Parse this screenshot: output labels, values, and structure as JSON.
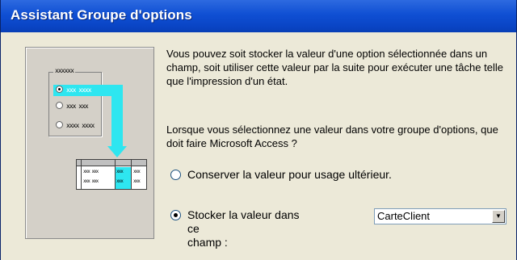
{
  "window": {
    "title": "Assistant Groupe d'options"
  },
  "illustration": {
    "group_label": "xxxxxx",
    "options": [
      "xxx xxxx",
      "xxx xxx",
      "xxxx xxxx"
    ],
    "table_cells": [
      "xxx xxx",
      "xxx",
      "xxx",
      "xxx xxx",
      "xxx",
      "xxx"
    ]
  },
  "content": {
    "paragraph1": "Vous pouvez soit stocker la valeur d'une option sélectionnée dans un champ, soit utiliser cette valeur par la suite pour exécuter une tâche telle que l'impression d'un état.",
    "paragraph2": "Lorsque vous sélectionnez une valeur dans votre groupe d'options, que doit faire Microsoft Access ?",
    "option_keep": "Conserver la valeur pour usage ultérieur.",
    "option_store_line1": "Stocker la valeur dans ce",
    "option_store_line2": "champ :",
    "option_store_mnemonic": "v",
    "field_value": "CarteClient",
    "selected_option": "store"
  }
}
